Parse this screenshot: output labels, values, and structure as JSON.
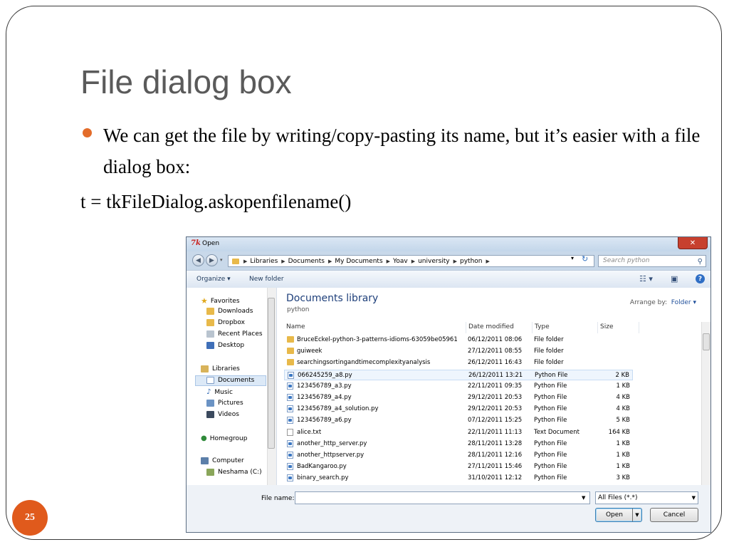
{
  "slide": {
    "title": "File dialog box",
    "bullet": "We can get the file by writing/copy-pasting its name, but it’s easier with a file dialog box:",
    "code": "t = tkFileDialog.askopenfilename()",
    "page_number": "25",
    "accent_color": "#e36c2a"
  },
  "dialog": {
    "title": "Open",
    "logo": "7k",
    "breadcrumb": [
      "Libraries",
      "Documents",
      "My Documents",
      "Yoav",
      "university",
      "python"
    ],
    "search_placeholder": "Search python",
    "toolbar": {
      "organize": "Organize ▾",
      "new_folder": "New folder"
    },
    "nav": {
      "favorites": "Favorites",
      "downloads": "Downloads",
      "dropbox": "Dropbox",
      "recent_places": "Recent Places",
      "desktop": "Desktop",
      "libraries": "Libraries",
      "documents": "Documents",
      "music": "Music",
      "pictures": "Pictures",
      "videos": "Videos",
      "homegroup": "Homegroup",
      "computer": "Computer",
      "drive": "Neshama (C:)"
    },
    "library_title": "Documents library",
    "library_sub": "python",
    "arrange_label": "Arrange by:",
    "arrange_value": "Folder ▾",
    "columns": {
      "name": "Name",
      "date": "Date modified",
      "type": "Type",
      "size": "Size"
    },
    "files": [
      {
        "name": "BruceEckel-python-3-patterns-idioms-63059be05961",
        "date": "06/12/2011 08:06",
        "type": "File folder",
        "size": "",
        "kind": "folder"
      },
      {
        "name": "guiweek",
        "date": "27/12/2011 08:55",
        "type": "File folder",
        "size": "",
        "kind": "folder"
      },
      {
        "name": "searchingsortingandtimecomplexityanalysis",
        "date": "26/12/2011 16:43",
        "type": "File folder",
        "size": "",
        "kind": "folder"
      },
      {
        "name": "066245259_a8.py",
        "date": "26/12/2011 13:21",
        "type": "Python File",
        "size": "2 KB",
        "kind": "py"
      },
      {
        "name": "123456789_a3.py",
        "date": "22/11/2011 09:35",
        "type": "Python File",
        "size": "1 KB",
        "kind": "py"
      },
      {
        "name": "123456789_a4.py",
        "date": "29/12/2011 20:53",
        "type": "Python File",
        "size": "4 KB",
        "kind": "py"
      },
      {
        "name": "123456789_a4_solution.py",
        "date": "29/12/2011 20:53",
        "type": "Python File",
        "size": "4 KB",
        "kind": "py"
      },
      {
        "name": "123456789_a6.py",
        "date": "07/12/2011 15:25",
        "type": "Python File",
        "size": "5 KB",
        "kind": "py"
      },
      {
        "name": "alice.txt",
        "date": "22/11/2011 11:13",
        "type": "Text Document",
        "size": "164 KB",
        "kind": "txt"
      },
      {
        "name": "another_http_server.py",
        "date": "28/11/2011 13:28",
        "type": "Python File",
        "size": "1 KB",
        "kind": "py"
      },
      {
        "name": "another_httpserver.py",
        "date": "28/11/2011 12:16",
        "type": "Python File",
        "size": "1 KB",
        "kind": "py"
      },
      {
        "name": "BadKangaroo.py",
        "date": "27/11/2011 15:46",
        "type": "Python File",
        "size": "1 KB",
        "kind": "py"
      },
      {
        "name": "binary_search.py",
        "date": "31/10/2011 12:12",
        "type": "Python File",
        "size": "3 KB",
        "kind": "py"
      }
    ],
    "file_name_label": "File name:",
    "file_name_value": "",
    "filter": "All Files (*.*)",
    "open_label": "Open",
    "cancel_label": "Cancel"
  }
}
